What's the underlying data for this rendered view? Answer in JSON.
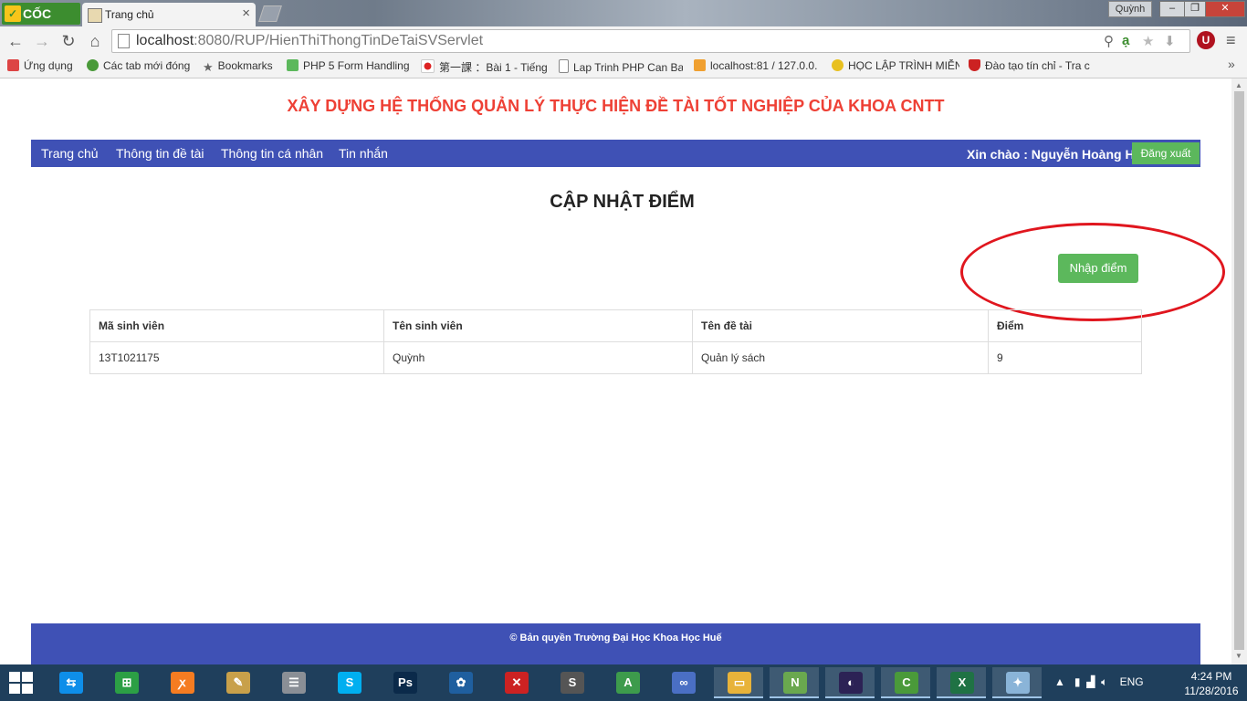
{
  "browser": {
    "brand": "CỐC CỐC",
    "tab_title": "Trang chủ",
    "user_badge": "Quỳnh",
    "url_host": "localhost",
    "url_path": ":8080/RUP/HienThiThongTinDeTaiSVServlet",
    "bookmarks": [
      {
        "label": "Ứng dụng",
        "icon": "apps-grid-icon",
        "color": "#d44"
      },
      {
        "label": "Các tab mới đóng",
        "icon": "history-icon",
        "color": "#4a9a3a"
      },
      {
        "label": "Bookmarks",
        "icon": "star-icon",
        "color": "#666"
      },
      {
        "label": "PHP 5 Form Handling",
        "icon": "w3-icon",
        "color": "#5cb85c"
      },
      {
        "label": "第一課 ：Bài 1 - Tiếng",
        "icon": "japan-flag-icon",
        "color": "#d22"
      },
      {
        "label": "Lap Trinh PHP Can Ba",
        "icon": "page-icon",
        "color": "#fff"
      },
      {
        "label": "localhost:81 / 127.0.0.",
        "icon": "pma-icon",
        "color": "#f0a030"
      },
      {
        "label": "HỌC LẬP TRÌNH MIỄN",
        "icon": "site-icon",
        "color": "#444"
      },
      {
        "label": "Đào tạo tín chỉ - Tra c",
        "icon": "shield-icon",
        "color": "#c22"
      }
    ]
  },
  "site": {
    "title": "XÂY DỰNG HỆ THỐNG QUẢN LÝ THỰC HIỆN ĐỀ TÀI TỐT NGHIỆP CỦA KHOA CNTT",
    "nav": [
      "Trang chủ",
      "Thông tin đề tài",
      "Thông tin cá nhân",
      "Tin nhắn"
    ],
    "greeting": "Xin chào : Nguyễn Hoàng Hà",
    "logout": "Đăng xuất",
    "accent": "#3f51b5",
    "title_color": "#ee4035",
    "button_color": "#5cb85c"
  },
  "main": {
    "heading": "CẬP NHẬT ĐIỂM",
    "input_score_button": "Nhập điểm",
    "table": {
      "headers": [
        "Mã sinh viên",
        "Tên sinh viên",
        "Tên đề tài",
        "Điểm"
      ],
      "rows": [
        [
          "13T1021175",
          "Quỳnh",
          "Quản lý sách",
          "9"
        ]
      ]
    }
  },
  "footer": {
    "copyright": "© Bản quyền Trường Đại Học Khoa Học Huế"
  },
  "taskbar": {
    "language": "ENG",
    "time": "4:24 PM",
    "date": "11/28/2016",
    "apps": [
      {
        "icon": "teamviewer-icon",
        "color": "#0e8ee9",
        "glyph": "⇆"
      },
      {
        "icon": "store-icon",
        "color": "#2c9f45",
        "glyph": "⊞"
      },
      {
        "icon": "xampp-icon",
        "color": "#f57c21",
        "glyph": "ꭗ"
      },
      {
        "icon": "tools-icon",
        "color": "#c8a04a",
        "glyph": "✎"
      },
      {
        "icon": "database-icon",
        "color": "#8a8f96",
        "glyph": "☰"
      },
      {
        "icon": "skype-icon",
        "color": "#00aff0",
        "glyph": "S"
      },
      {
        "icon": "photoshop-icon",
        "color": "#0b2a4a",
        "glyph": "Ps"
      },
      {
        "icon": "sourcetree-icon",
        "color": "#1f5f9f",
        "glyph": "✿"
      },
      {
        "icon": "filezilla-icon",
        "color": "#c22",
        "glyph": "✕"
      },
      {
        "icon": "sublime-icon",
        "color": "#555",
        "glyph": "S"
      },
      {
        "icon": "android-studio-icon",
        "color": "#3d9b4c",
        "glyph": "A"
      },
      {
        "icon": "infinity-icon",
        "color": "#4a6fc4",
        "glyph": "∞"
      },
      {
        "icon": "file-explorer-icon",
        "color": "#e8b33a",
        "glyph": "▭"
      },
      {
        "icon": "notepadpp-icon",
        "color": "#6aa84f",
        "glyph": "N"
      },
      {
        "icon": "eclipse-icon",
        "color": "#2c2255",
        "glyph": "◐"
      },
      {
        "icon": "coccoc-icon",
        "color": "#4a9a3a",
        "glyph": "C"
      },
      {
        "icon": "excel-icon",
        "color": "#1f7244",
        "glyph": "X"
      },
      {
        "icon": "paint-icon",
        "color": "#8ab4d8",
        "glyph": "✦"
      }
    ]
  }
}
